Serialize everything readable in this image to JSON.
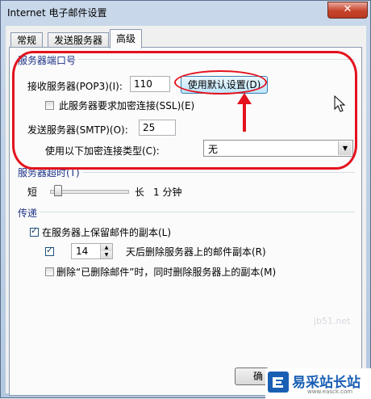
{
  "window": {
    "title": "Internet 电子邮件设置",
    "close_label": "✕"
  },
  "tabs": [
    {
      "label": "常规"
    },
    {
      "label": "发送服务器"
    },
    {
      "label": "高级"
    }
  ],
  "ports_group": {
    "label": "服务器端口号",
    "incoming_label": "接收服务器(POP3)(I):",
    "incoming_value": "110",
    "default_button": "使用默认设置(D)",
    "ssl_label": "此服务器要求加密连接(SSL)(E)",
    "ssl_checked": false,
    "outgoing_label": "发送服务器(SMTP)(O):",
    "outgoing_value": "25",
    "encryption_label": "使用以下加密连接类型(C):",
    "encryption_value": "无"
  },
  "timeout_group": {
    "label": "服务器超时(T)",
    "short_label": "短",
    "long_label": "长",
    "value_text": "1 分钟",
    "level": 0.05
  },
  "delivery_group": {
    "label": "传递",
    "keep_copy_label": "在服务器上保留邮件的副本(L)",
    "keep_copy_checked": true,
    "remove_after_checked": true,
    "remove_after_days": "14",
    "remove_after_label": "天后删除服务器上的邮件副本(R)",
    "remove_deleted_label": "删除“已删除邮件”时，同时删除服务器上的副本(M)",
    "remove_deleted_checked": false
  },
  "footer": {
    "ok_label": "确定"
  },
  "watermark": {
    "text": "易采站长站",
    "url": "www.easck.com",
    "faint": "jb51.net"
  }
}
